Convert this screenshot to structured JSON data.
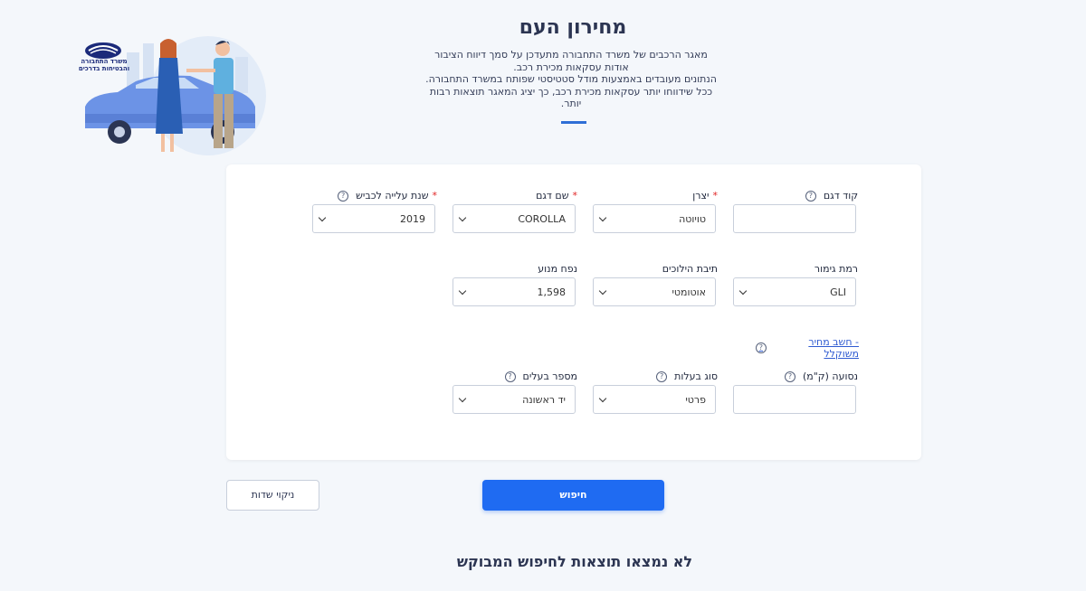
{
  "header": {
    "title": "מחירון העם",
    "intro_lines": [
      "מאגר הרכבים של משרד התחבורה מתעדכן על סמך דיווח הציבור",
      "אודות עסקאות מכירת רכב.",
      "הנתונים מעובדים באמצעות מודל סטטיסטי שפותח במשרד התחבורה.",
      "ככל שידווחו יותר עסקאות מכירת רכב, כך יציג המאגר תוצאות רבות",
      "יותר."
    ],
    "logo_text": "משרד התחבורה והבטיחות בדרכים"
  },
  "form": {
    "model_code": {
      "label": "קוד דגם",
      "value": ""
    },
    "manufacturer": {
      "label": "יצרן",
      "required": "*",
      "value": "טויוטה"
    },
    "model_name": {
      "label": "שם דגם",
      "required": "*",
      "value": "COROLLA"
    },
    "year": {
      "label": "שנת עלייה לכביש",
      "required": "*",
      "value": "2019"
    },
    "trim": {
      "label": "רמת גימור",
      "value": "GLI"
    },
    "gearbox": {
      "label": "תיבת הילוכים",
      "value": "אוטומטי"
    },
    "engine": {
      "label": "נפח מנוע",
      "value": "1,598"
    },
    "calc_link": "- חשב מחיר משוקלל",
    "mileage": {
      "label": "נסועה (ק\"מ)",
      "value": ""
    },
    "ownership_type": {
      "label": "סוג בעלות",
      "value": "פרטי"
    },
    "owners_count": {
      "label": "מספר בעלים",
      "value": "יד ראשונה"
    }
  },
  "actions": {
    "search": "חיפוש",
    "clear": "ניקוי שדות"
  },
  "results": {
    "message": "לא נמצאו תוצאות לחיפוש המבוקש"
  },
  "colors": {
    "primary": "#1f6bf2",
    "link": "#2f5bd1",
    "required": "#e02424"
  }
}
